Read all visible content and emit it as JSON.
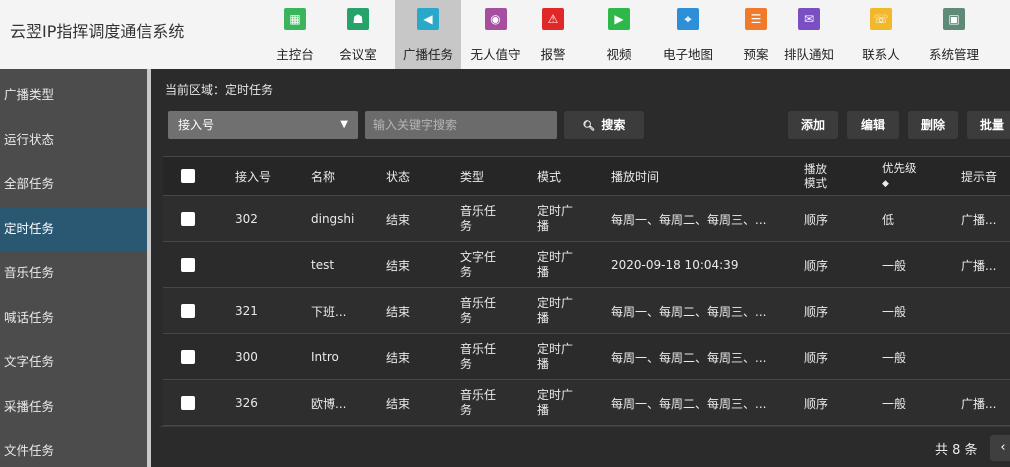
{
  "app": {
    "title": "云翌IP指挥调度通信系统"
  },
  "nav": {
    "items": [
      {
        "label": "主控台",
        "icon": "dashboard-icon",
        "color": "#3bb55c",
        "glyph": "▦"
      },
      {
        "label": "会议室",
        "icon": "meeting-icon",
        "color": "#25a36a",
        "glyph": "☗"
      },
      {
        "label": "广播任务",
        "icon": "broadcast-icon",
        "color": "#2aa8c9",
        "glyph": "◀"
      },
      {
        "label": "无人值守",
        "icon": "unattended-icon",
        "color": "#a54f9e",
        "glyph": "◉"
      },
      {
        "label": "报警",
        "icon": "alarm-icon",
        "color": "#e02828",
        "glyph": "⚠"
      },
      {
        "label": "视频",
        "icon": "video-icon",
        "color": "#2eb84a",
        "glyph": "▶"
      },
      {
        "label": "电子地图",
        "icon": "map-icon",
        "color": "#2d8fd8",
        "glyph": "⌖"
      },
      {
        "label": "预案",
        "icon": "plan-icon",
        "color": "#f07a2a",
        "glyph": "☰"
      },
      {
        "label": "排队通知",
        "icon": "queue-icon",
        "color": "#7a4fc2",
        "glyph": "✉"
      },
      {
        "label": "联系人",
        "icon": "contacts-icon",
        "color": "#f2b82c",
        "glyph": "☏"
      },
      {
        "label": "系统管理",
        "icon": "settings-icon",
        "color": "#5f8a78",
        "glyph": "▣"
      }
    ],
    "active_index": 2
  },
  "sidebar": {
    "items": [
      {
        "label": "广播类型"
      },
      {
        "label": "运行状态"
      },
      {
        "label": "全部任务"
      },
      {
        "label": "定时任务"
      },
      {
        "label": "音乐任务"
      },
      {
        "label": "喊话任务"
      },
      {
        "label": "文字任务"
      },
      {
        "label": "采播任务"
      },
      {
        "label": "文件任务"
      }
    ],
    "active_index": 3
  },
  "breadcrumb": {
    "prefix": "当前区域",
    "separator": "：",
    "current": "定时任务"
  },
  "toolbar": {
    "select_value": "接入号",
    "search_placeholder": "输入关键字搜索",
    "search_label": "搜索",
    "add_label": "添加",
    "edit_label": "编辑",
    "delete_label": "删除",
    "batch_label": "批量"
  },
  "table": {
    "headers": {
      "access": "接入号",
      "name": "名称",
      "status": "状态",
      "type": "类型",
      "mode": "模式",
      "play_time": "播放时间",
      "play_mode": "播放模式",
      "priority": "优先级",
      "prompt": "提示音"
    },
    "rows": [
      {
        "access": "302",
        "name": "dingshi",
        "status": "结束",
        "type": "音乐任务",
        "mode": "定时广播",
        "play_time": "每周一、每周二、每周三、...",
        "play_mode": "顺序",
        "priority": "低",
        "prompt": "广播..."
      },
      {
        "access": "",
        "name": "test",
        "status": "结束",
        "type": "文字任务",
        "mode": "定时广播",
        "play_time": "2020-09-18 10:04:39",
        "play_mode": "顺序",
        "priority": "一般",
        "prompt": "广播..."
      },
      {
        "access": "321",
        "name": "下班...",
        "status": "结束",
        "type": "音乐任务",
        "mode": "定时广播",
        "play_time": "每周一、每周二、每周三、...",
        "play_mode": "顺序",
        "priority": "一般",
        "prompt": ""
      },
      {
        "access": "300",
        "name": "Intro",
        "status": "结束",
        "type": "音乐任务",
        "mode": "定时广播",
        "play_time": "每周一、每周二、每周三、...",
        "play_mode": "顺序",
        "priority": "一般",
        "prompt": ""
      },
      {
        "access": "326",
        "name": "欧博...",
        "status": "结束",
        "type": "音乐任务",
        "mode": "定时广播",
        "play_time": "每周一、每周二、每周三、...",
        "play_mode": "顺序",
        "priority": "一般",
        "prompt": "广播..."
      }
    ]
  },
  "pagination": {
    "total_text": "共 8 条",
    "prev": "‹"
  }
}
